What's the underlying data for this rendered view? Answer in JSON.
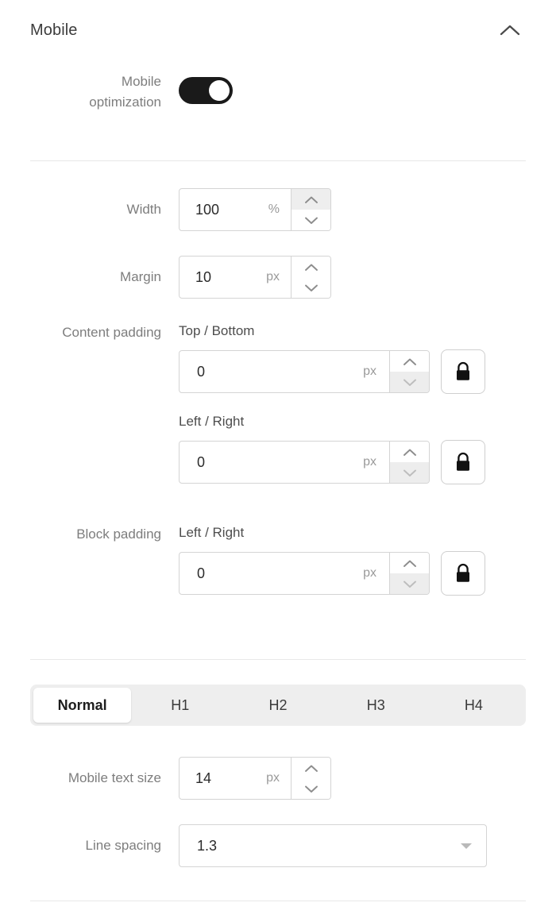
{
  "section": {
    "title": "Mobile",
    "collapse_icon": "chevron-up-icon"
  },
  "mobile_optimization": {
    "label_line1": "Mobile",
    "label_line2": "optimization",
    "state": "on"
  },
  "width": {
    "label": "Width",
    "value": "100",
    "unit": "%",
    "increment_icon": "chevron-up-icon",
    "decrement_icon": "chevron-down-icon"
  },
  "margin": {
    "label": "Margin",
    "value": "10",
    "unit": "px",
    "increment_icon": "chevron-up-icon",
    "decrement_icon": "chevron-down-icon"
  },
  "content_padding": {
    "label": "Content padding",
    "items": [
      {
        "sublabel": "Top / Bottom",
        "value": "0",
        "unit": "px",
        "lock_icon": "lock-closed-icon",
        "lock_state": "locked"
      },
      {
        "sublabel": "Left / Right",
        "value": "0",
        "unit": "px",
        "lock_icon": "lock-closed-icon",
        "lock_state": "locked"
      }
    ]
  },
  "block_padding": {
    "label": "Block padding",
    "items": [
      {
        "sublabel": "Left / Right",
        "value": "0",
        "unit": "px",
        "lock_icon": "lock-closed-icon",
        "lock_state": "locked"
      }
    ]
  },
  "text_style_tabs": {
    "selected": "Normal",
    "items": [
      {
        "label": "Normal"
      },
      {
        "label": "H1"
      },
      {
        "label": "H2"
      },
      {
        "label": "H3"
      },
      {
        "label": "H4"
      }
    ]
  },
  "mobile_text_size": {
    "label": "Mobile text size",
    "value": "14",
    "unit": "px",
    "increment_icon": "chevron-up-icon",
    "decrement_icon": "chevron-down-icon"
  },
  "line_spacing": {
    "label": "Line spacing",
    "value": "1.3",
    "caret_icon": "caret-down-icon"
  },
  "colors": {
    "toggle_on": "#1a1a1a",
    "border": "#d4d4d4",
    "divider": "#e8e8e8",
    "label_text": "#7d7d7d",
    "value_text": "#2b2b2b",
    "unit_text": "#9a9a9a",
    "tabbar_bg": "#eeeeee"
  }
}
